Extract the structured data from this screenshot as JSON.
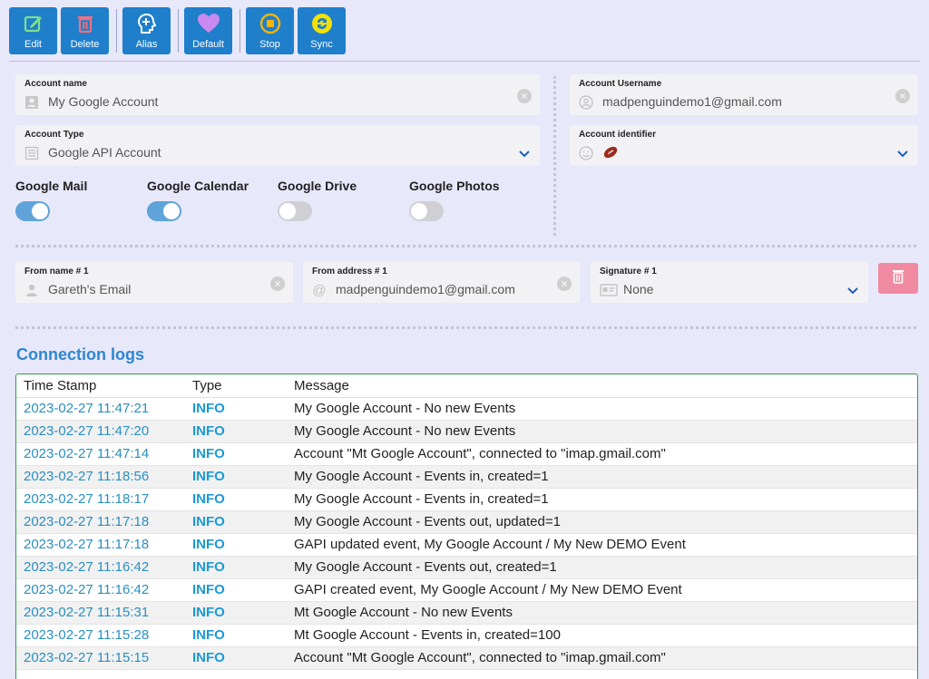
{
  "toolbar": {
    "edit": "Edit",
    "delete": "Delete",
    "alias": "Alias",
    "default": "Default",
    "stop": "Stop",
    "sync": "Sync"
  },
  "account": {
    "name_label": "Account name",
    "name_value": "My Google Account",
    "username_label": "Account Username",
    "username_value": "madpenguindemo1@gmail.com",
    "type_label": "Account Type",
    "type_value": "Google API Account",
    "identifier_label": "Account identifier",
    "identifier_icon": "football-icon"
  },
  "services": [
    {
      "label": "Google Mail",
      "enabled": true
    },
    {
      "label": "Google Calendar",
      "enabled": true
    },
    {
      "label": "Google Drive",
      "enabled": false
    },
    {
      "label": "Google Photos",
      "enabled": false
    }
  ],
  "from": {
    "name_label": "From name # 1",
    "name_value": "Gareth's Email",
    "address_label": "From address # 1",
    "address_value": "madpenguindemo1@gmail.com",
    "signature_label": "Signature # 1",
    "signature_value": "None"
  },
  "logs": {
    "title": "Connection logs",
    "columns": [
      "Time Stamp",
      "Type",
      "Message"
    ],
    "rows": [
      [
        "2023-02-27 11:47:21",
        "INFO",
        "My Google Account - No new Events"
      ],
      [
        "2023-02-27 11:47:20",
        "INFO",
        "My Google Account - No new Events"
      ],
      [
        "2023-02-27 11:47:14",
        "INFO",
        "Account \"Mt Google Account\", connected to \"imap.gmail.com\""
      ],
      [
        "2023-02-27 11:18:56",
        "INFO",
        "My Google Account - Events in, created=1"
      ],
      [
        "2023-02-27 11:18:17",
        "INFO",
        "My Google Account - Events in, created=1"
      ],
      [
        "2023-02-27 11:17:18",
        "INFO",
        "My Google Account - Events out, updated=1"
      ],
      [
        "2023-02-27 11:17:18",
        "INFO",
        "GAPI updated event, My Google Account / My New DEMO Event"
      ],
      [
        "2023-02-27 11:16:42",
        "INFO",
        "My Google Account - Events out, created=1"
      ],
      [
        "2023-02-27 11:16:42",
        "INFO",
        "GAPI created event, My Google Account / My New DEMO Event"
      ],
      [
        "2023-02-27 11:15:31",
        "INFO",
        "Mt Google Account - No new Events"
      ],
      [
        "2023-02-27 11:15:28",
        "INFO",
        "Mt Google Account - Events in, created=100"
      ],
      [
        "2023-02-27 11:15:15",
        "INFO",
        "Account \"Mt Google Account\", connected to \"imap.gmail.com\""
      ]
    ]
  },
  "colors": {
    "background": "#e8e8fb",
    "toolbar_button": "#1f7fcb",
    "accent_link": "#2f86cf",
    "delete_button": "#f08aa0",
    "toggle_on": "#5fa3d8"
  }
}
